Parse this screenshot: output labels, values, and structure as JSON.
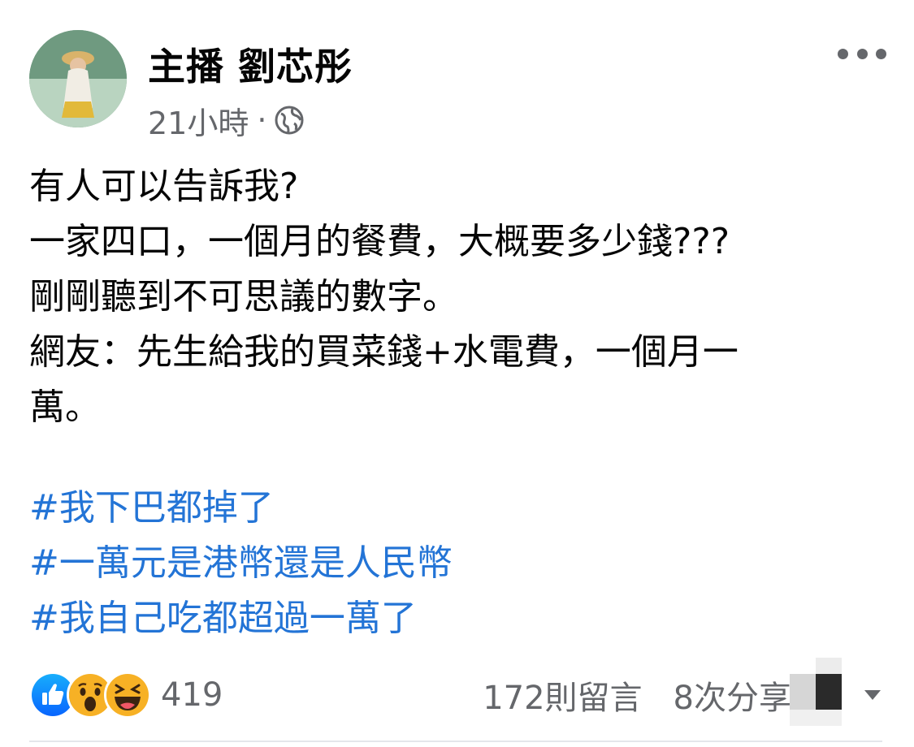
{
  "post": {
    "author": "主播 劉芯彤",
    "timestamp": "21小時",
    "separator": "·",
    "privacy_icon": "globe-icon",
    "more_icon": "more-horizontal-icon",
    "body_lines": [
      "有人可以告訴我?",
      "一家四口，一個月的餐費，大概要多少錢???",
      "剛剛聽到不可思議的數字。",
      "網友：先生給我的買菜錢+水電費，一個月一",
      "萬。"
    ],
    "hashtags": [
      "#我下巴都掉了",
      "#一萬元是港幣還是人民幣",
      "#我自己吃都超過一萬了"
    ],
    "reactions": {
      "icons": [
        "like-icon",
        "wow-icon",
        "haha-icon"
      ],
      "count": "419"
    },
    "comments": "172則留言",
    "shares": "8次分享",
    "colors": {
      "hashtag": "#2374d6",
      "meta": "#65676b",
      "like": "#1877f2",
      "emoji": "#f7b125"
    }
  }
}
